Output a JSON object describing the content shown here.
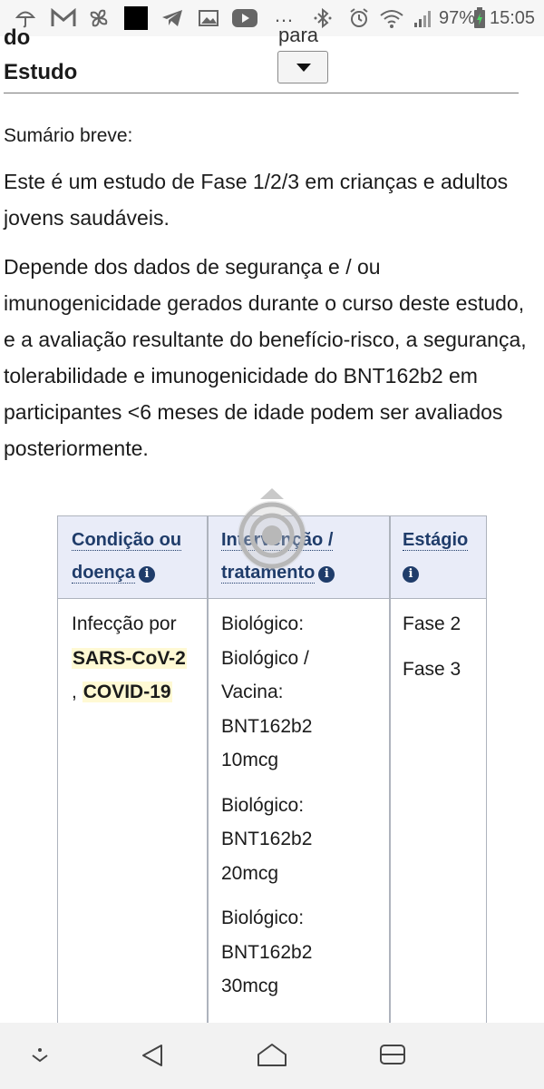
{
  "status_bar": {
    "battery_percent": "97%",
    "time": "15:05",
    "icons": [
      "umbrella-icon",
      "gmail-icon",
      "pinwheel-icon",
      "black-square-icon",
      "telegram-icon",
      "image-icon",
      "youtube-icon",
      "more-dots-icon",
      "bluetooth-icon",
      "alarm-icon",
      "wifi-icon",
      "signal-icon",
      "battery-charging-icon"
    ],
    "more_dots": "…"
  },
  "header": {
    "partial_word": "do",
    "title": "Estudo",
    "dropdown_label_partial": "para"
  },
  "summary": {
    "label": "Sumário breve:",
    "paragraph1": "Este é um estudo de Fase 1/2/3 em crianças e adultos jovens saudáveis.",
    "paragraph2": "Depende dos dados de segurança e / ou imunogenicidade gerados durante o curso deste estudo, e a avaliação resultante do benefício-risco, a segurança, tolerabilidade e imunogenicidade do BNT162b2 em participantes <6 meses de idade podem ser avaliados posteriormente."
  },
  "table": {
    "headers": {
      "condition_line1": "Condição ou",
      "condition_line2": "doença",
      "intervention_line1": "Intervenção /",
      "intervention_line2": "tratamento",
      "stage": "Estágio"
    },
    "info_glyph": "i",
    "condition": {
      "prefix": "Infecção por",
      "term1": "SARS-CoV-2",
      "separator": ",",
      "term2": "COVID-19"
    },
    "interventions": [
      [
        "Biológico:",
        "Biológico /",
        "Vacina:",
        "BNT162b2",
        "10mcg"
      ],
      [
        "Biológico:",
        "BNT162b2",
        "20mcg"
      ],
      [
        "Biológico:",
        "BNT162b2",
        "30mcg"
      ]
    ],
    "stages": [
      "Fase 2",
      "Fase 3"
    ]
  },
  "nav_bar": {
    "buttons": [
      "chevron-down-icon",
      "back-icon",
      "home-icon",
      "recents-icon"
    ]
  },
  "colors": {
    "header_bg": "#e9ecf8",
    "header_text": "#1f3c6a",
    "highlight": "#fff9d4",
    "status_bar_bg": "#f6f6f6",
    "nav_bar_bg": "#f2f2f2"
  }
}
